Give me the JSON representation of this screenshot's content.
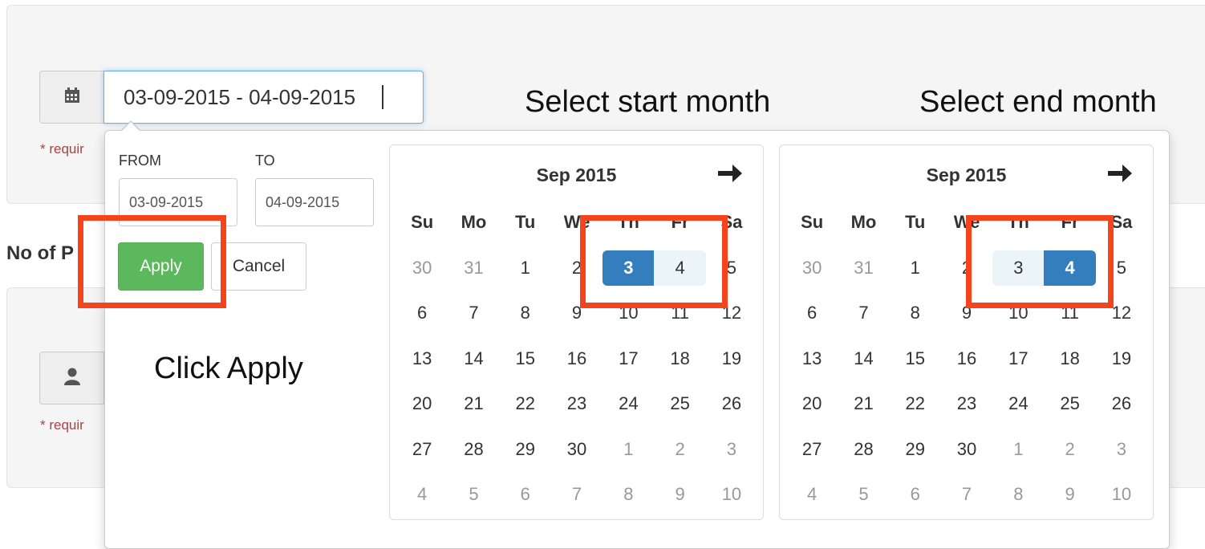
{
  "date_range": {
    "value": "03-09-2015 - 04-09-2015",
    "required_text": "* requir"
  },
  "section_title": "No of P",
  "persons": {
    "required_text": "* requir"
  },
  "picker": {
    "from_label": "FROM",
    "to_label": "TO",
    "from_value": "03-09-2015",
    "to_value": "04-09-2015",
    "apply_label": "Apply",
    "cancel_label": "Cancel",
    "weekdays": [
      "Su",
      "Mo",
      "Tu",
      "We",
      "Th",
      "Fr",
      "Sa"
    ],
    "left_calendar": {
      "month": "Sep 2015",
      "selected_start": 3,
      "selected_end": 4
    },
    "right_calendar": {
      "month": "Sep 2015",
      "selected_start": 3,
      "selected_end": 4
    },
    "days": [
      [
        30,
        31,
        1,
        2,
        3,
        4,
        5
      ],
      [
        6,
        7,
        8,
        9,
        10,
        11,
        12
      ],
      [
        13,
        14,
        15,
        16,
        17,
        18,
        19
      ],
      [
        20,
        21,
        22,
        23,
        24,
        25,
        26
      ],
      [
        27,
        28,
        29,
        30,
        1,
        2,
        3
      ],
      [
        4,
        5,
        6,
        7,
        8,
        9,
        10
      ]
    ]
  },
  "annotations": {
    "start": "Select start month",
    "end": "Select end month",
    "apply": "Click Apply"
  },
  "colors": {
    "primary": "#357ebd",
    "success": "#5cb85c",
    "highlight": "#f5441c",
    "error": "#a94442"
  }
}
